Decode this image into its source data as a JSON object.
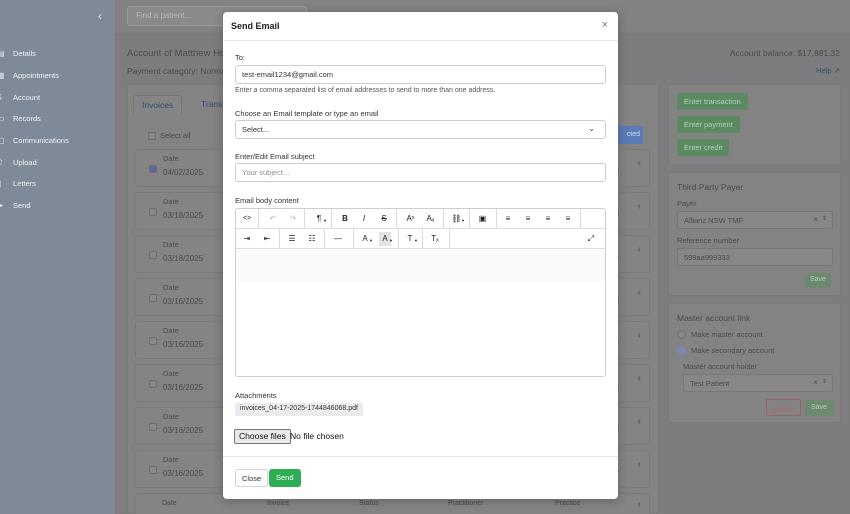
{
  "sidebar": {
    "collapse_icon": "chevron-left-icon",
    "items": [
      {
        "label": "Details",
        "icon": "document-icon"
      },
      {
        "label": "Appointments",
        "icon": "calendar-icon"
      },
      {
        "label": "Account",
        "icon": "dollar-icon"
      },
      {
        "label": "Records",
        "icon": "records-icon"
      },
      {
        "label": "Communications",
        "icon": "chat-icon"
      },
      {
        "label": "Upload",
        "icon": "upload-icon"
      },
      {
        "label": "Letters",
        "icon": "letter-icon"
      },
      {
        "label": "Send",
        "icon": "send-icon"
      }
    ]
  },
  "topbar": {
    "search_placeholder": "Find a patient..."
  },
  "account": {
    "title": "Account of Matthew Ho",
    "balance": "Account balance: $17,881.32",
    "payment_category": "Payment category: Norma",
    "help": "Help"
  },
  "tabs": [
    {
      "label": "Invoices"
    },
    {
      "label": "Transac"
    }
  ],
  "invoice_list": {
    "select_all": "Select all",
    "selected_btn": "cted",
    "rows": [
      {
        "date_label": "Date",
        "date": "04/02/2025",
        "checked": true,
        "tail": "e"
      },
      {
        "date_label": "Date",
        "date": "03/18/2025",
        "checked": false,
        "tail": "e"
      },
      {
        "date_label": "Date",
        "date": "03/18/2025",
        "checked": false,
        "tail": "e"
      },
      {
        "date_label": "Date",
        "date": "03/16/2025",
        "checked": false,
        "tail": "e"
      },
      {
        "date_label": "Date",
        "date": "03/16/2025",
        "checked": false,
        "tail": "e"
      },
      {
        "date_label": "Date",
        "date": "03/16/2025",
        "checked": false,
        "tail": "e"
      },
      {
        "date_label": "Date",
        "date": "03/16/2025",
        "checked": false,
        "tail": "e"
      },
      {
        "date_label": "Date",
        "date": "03/16/2025",
        "checked": false,
        "tail": "e"
      }
    ],
    "footer_labels": [
      "Date",
      "Invoice",
      "Status",
      "Practitioner",
      "Practice"
    ]
  },
  "actions": {
    "enter_transaction": "Enter transaction",
    "enter_payment": "Enter payment",
    "enter_credit": "Enter credit"
  },
  "third_party": {
    "title": "Third Party Payer",
    "payer_label": "Payer",
    "payer_value": "Allianz NSW TMF",
    "ref_label": "Reference number",
    "ref_value": "599aa999333",
    "save": "Save"
  },
  "master_link": {
    "title": "Master account link",
    "make_master": "Make master account",
    "make_secondary": "Make secondary account",
    "holder_label": "Master account holder",
    "holder_value": "Test Patient",
    "unlink": "Unlink",
    "save": "Save"
  },
  "modal": {
    "title": "Send Email",
    "to_label": "To:",
    "to_value": "test-email1234@gmail.com",
    "to_help": "Enter a comma separated list of email addresses to send to more than one address.",
    "template_label": "Choose an Email template or type an email",
    "template_value": "Select...",
    "subject_label": "Enter/Edit Email subject",
    "subject_placeholder": "Your subject...",
    "body_label": "Email body content",
    "attachments_label": "Attachments",
    "attachment_file": "invoices_04-17-2025-1744846068.pdf",
    "choose_files": "Choose files",
    "no_file": "No file chosen",
    "close_btn": "Close",
    "send_btn": "Send"
  },
  "toolbar": {
    "row1": [
      {
        "name": "code-view-icon",
        "glyph": "<>"
      },
      {
        "name": "undo-icon",
        "glyph": "↶"
      },
      {
        "name": "redo-icon",
        "glyph": "↷"
      },
      {
        "name": "paragraph-icon",
        "glyph": "¶"
      },
      {
        "name": "bold-icon",
        "glyph": "B"
      },
      {
        "name": "italic-icon",
        "glyph": "I"
      },
      {
        "name": "strikethrough-icon",
        "glyph": "S"
      },
      {
        "name": "superscript-icon",
        "glyph": "Aˣ"
      },
      {
        "name": "subscript-icon",
        "glyph": "Aₓ"
      },
      {
        "name": "link-icon",
        "glyph": "⛓"
      },
      {
        "name": "image-icon",
        "glyph": "▣"
      },
      {
        "name": "align-left-icon",
        "glyph": "≡"
      },
      {
        "name": "align-center-icon",
        "glyph": "≡"
      },
      {
        "name": "align-right-icon",
        "glyph": "≡"
      },
      {
        "name": "align-justify-icon",
        "glyph": "≡"
      }
    ],
    "row2": [
      {
        "name": "indent-icon",
        "glyph": "⇥"
      },
      {
        "name": "outdent-icon",
        "glyph": "⇤"
      },
      {
        "name": "bullet-list-icon",
        "glyph": "☰"
      },
      {
        "name": "numbered-list-icon",
        "glyph": "☷"
      },
      {
        "name": "horizontal-rule-icon",
        "glyph": "—"
      },
      {
        "name": "font-color-icon",
        "glyph": "A"
      },
      {
        "name": "highlight-color-icon",
        "glyph": "A"
      },
      {
        "name": "font-size-icon",
        "glyph": "T"
      },
      {
        "name": "clear-format-icon",
        "glyph": "Tₓ"
      },
      {
        "name": "fullscreen-icon",
        "glyph": "⤢"
      }
    ]
  },
  "colors": {
    "send": "#2dae55",
    "selected_blue": "#5b7bb7",
    "action_green": "#5c8a62"
  }
}
